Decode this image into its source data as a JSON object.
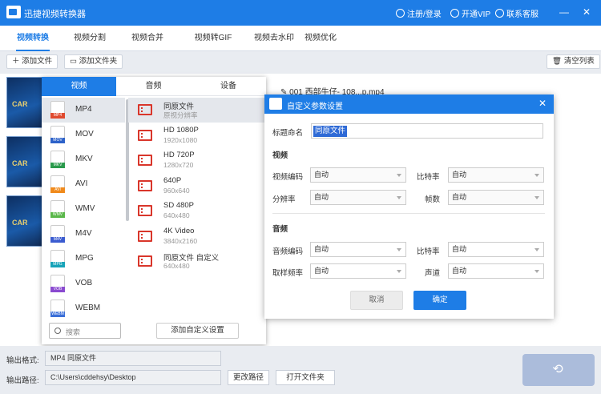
{
  "app": {
    "title": "迅捷视频转换器",
    "register_login": "注册/登录",
    "open_vip": "开通VIP",
    "contact": "联系客服",
    "minimize": "—",
    "close": "✕"
  },
  "tabs": [
    "视频转换",
    "视频分割",
    "视频合并",
    "视频转GIF",
    "视频去水印",
    "视频优化"
  ],
  "toolbar": {
    "add_file": "添加文件",
    "add_folder": "添加文件夹",
    "clear_list": "清空列表"
  },
  "file": {
    "name": "001 西部牛仔- 108...p.mp4",
    "thumb_text": "CAR"
  },
  "format_panel": {
    "tabs": [
      "视频",
      "音频",
      "设备"
    ],
    "formats": [
      {
        "name": "MP4",
        "color": "#e04a2f"
      },
      {
        "name": "MOV",
        "color": "#2d62c9"
      },
      {
        "name": "MKV",
        "color": "#2a9a4c"
      },
      {
        "name": "AVI",
        "color": "#f08a1c"
      },
      {
        "name": "WMV",
        "color": "#5ab74a"
      },
      {
        "name": "M4V",
        "color": "#3a5bd0"
      },
      {
        "name": "MPG",
        "color": "#17a3b8"
      },
      {
        "name": "VOB",
        "color": "#8a4ad0"
      },
      {
        "name": "WEBM",
        "color": "#3b6fd8"
      }
    ],
    "qualities": [
      {
        "title": "同原文件",
        "sub": "原视分辨率"
      },
      {
        "title": "HD 1080P",
        "sub": "1920x1080"
      },
      {
        "title": "HD 720P",
        "sub": "1280x720"
      },
      {
        "title": "640P",
        "sub": "960x640"
      },
      {
        "title": "SD 480P",
        "sub": "640x480"
      },
      {
        "title": "4K Video",
        "sub": "3840x2160"
      },
      {
        "title": "同原文件 自定义",
        "sub": "640x480"
      }
    ],
    "search_placeholder": "搜索",
    "add_custom": "添加自定义设置"
  },
  "dialog": {
    "title": "自定义参数设置",
    "name_label": "标题命名",
    "name_value": "同原文件",
    "video_section": "视频",
    "video_codec_label": "视频编码",
    "video_codec": "自动",
    "bitrate_label": "比特率",
    "bitrate": "自动",
    "resolution_label": "分辨率",
    "resolution": "自动",
    "framerate_label": "帧数",
    "framerate": "自动",
    "audio_section": "音频",
    "audio_codec_label": "音频编码",
    "audio_codec": "自动",
    "audio_bitrate_label": "比特率",
    "audio_bitrate": "自动",
    "samplerate_label": "取样频率",
    "samplerate": "自动",
    "channels_label": "声道",
    "channels": "自动",
    "cancel": "取消",
    "ok": "确定"
  },
  "bottom": {
    "output_format_label": "输出格式:",
    "output_format": "MP4  同原文件",
    "output_path_label": "输出路径:",
    "output_path": "C:\\Users\\cddehsy\\Desktop",
    "change_path": "更改路径",
    "open_folder": "打开文件夹"
  },
  "colors": {
    "accent": "#1e7de6"
  }
}
